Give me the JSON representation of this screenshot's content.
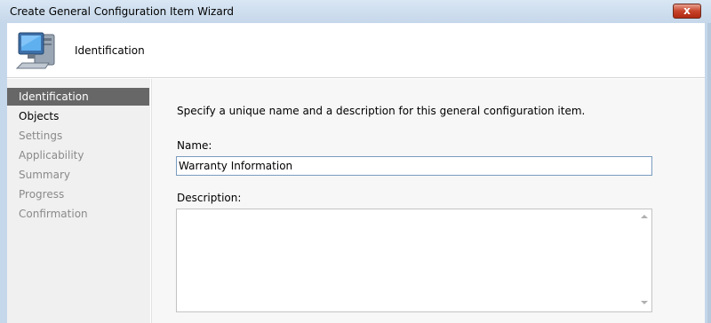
{
  "window": {
    "title": "Create General Configuration Item Wizard",
    "close_glyph": "x"
  },
  "header": {
    "title": "Identification",
    "icon": "computer-icon"
  },
  "nav": {
    "items": [
      {
        "label": "Identification",
        "state": "active"
      },
      {
        "label": "Objects",
        "state": "enabled"
      },
      {
        "label": "Settings",
        "state": "disabled"
      },
      {
        "label": "Applicability",
        "state": "disabled"
      },
      {
        "label": "Summary",
        "state": "disabled"
      },
      {
        "label": "Progress",
        "state": "disabled"
      },
      {
        "label": "Confirmation",
        "state": "disabled"
      }
    ]
  },
  "form": {
    "instruction": "Specify a unique name and a description for this general configuration item.",
    "name_label": "Name:",
    "name_value": "Warranty Information",
    "description_label": "Description:",
    "description_value": ""
  },
  "colors": {
    "nav_active_bg": "#676767",
    "close_button": "#c7432a",
    "frame": "#c5d7ea"
  }
}
